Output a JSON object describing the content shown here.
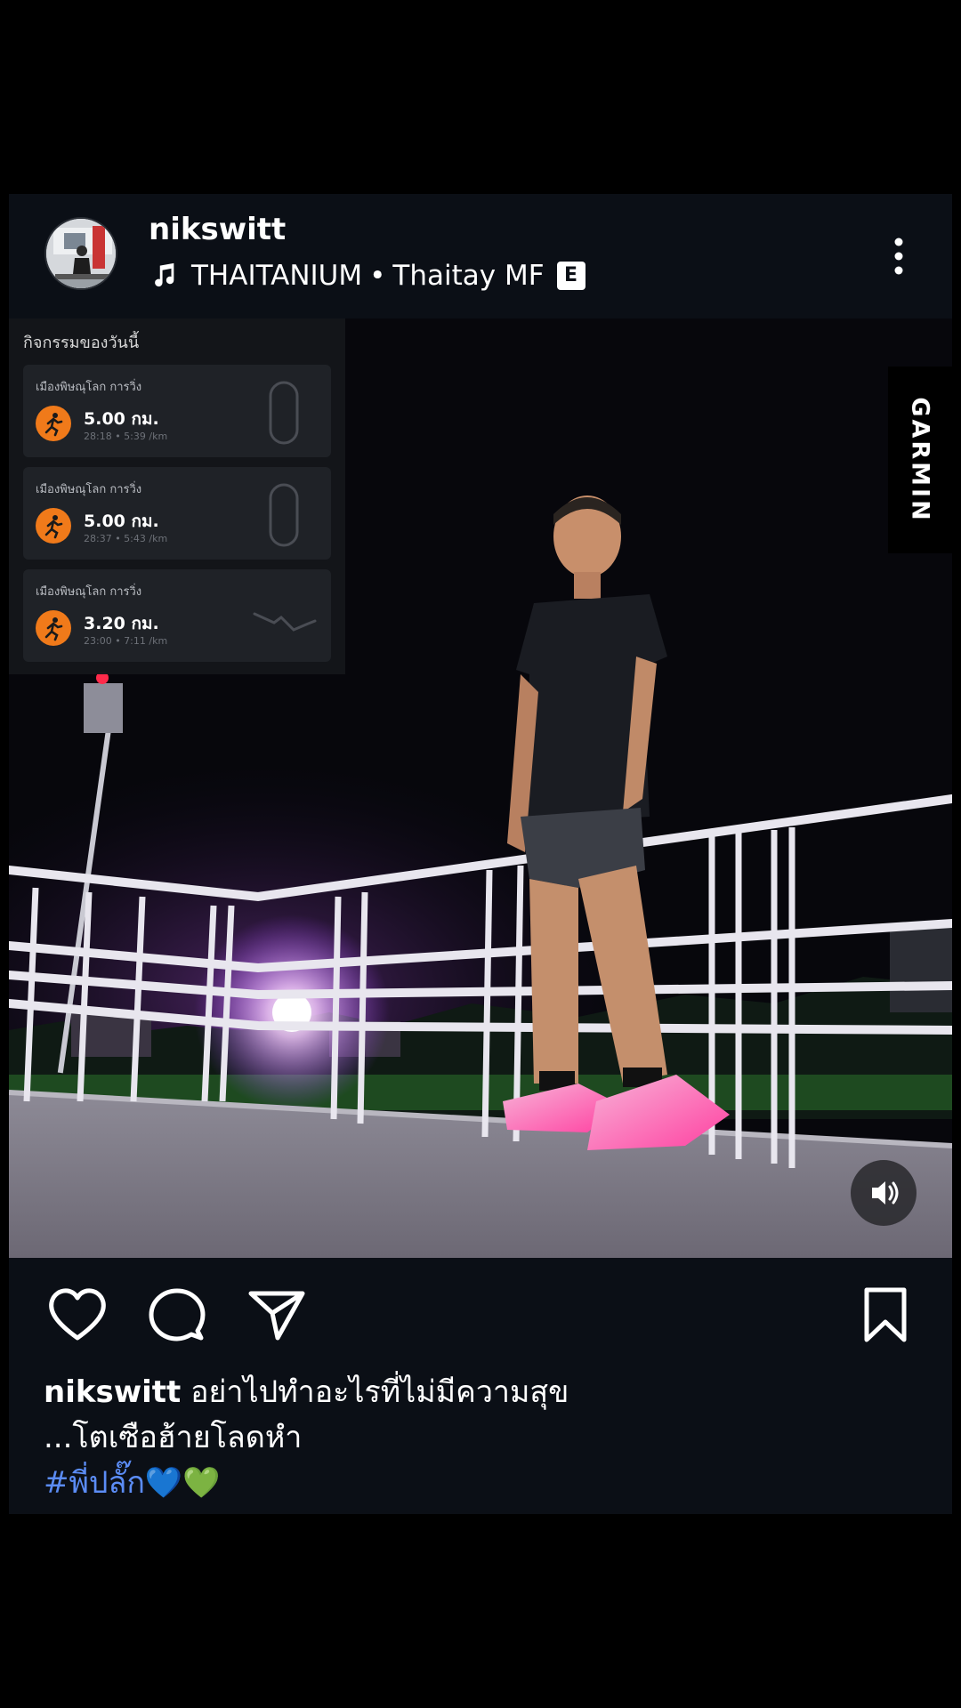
{
  "post": {
    "username": "nikswitt",
    "music": {
      "title": "THAITANIUM",
      "separator": "•",
      "artist": "Thaitay MF",
      "explicit_badge": "E"
    },
    "icons": {
      "music": "music-note-icon",
      "more": "more-vertical-icon",
      "sound": "speaker-icon",
      "like": "heart-icon",
      "comment": "comment-bubble-icon",
      "share": "send-paper-plane-icon",
      "save": "bookmark-icon"
    },
    "activity_overlay": {
      "title": "กิจกรรมของวันนี้",
      "items": [
        {
          "location": "เมืองพิษณุโลก การวิ่ง",
          "distance": "5.00 กม.",
          "detail": "28:18 • 5:39 /km"
        },
        {
          "location": "เมืองพิษณุโลก การวิ่ง",
          "distance": "5.00 กม.",
          "detail": "28:37 • 5:43 /km"
        },
        {
          "location": "เมืองพิษณุโลก การวิ่ง",
          "distance": "3.20 กม.",
          "detail": "23:00 • 7:11 /km"
        }
      ]
    },
    "brand_tag": "GARMIN",
    "caption": {
      "username": "nikswitt",
      "line1": "อย่าไปทำอะไรที่ไม่มีความสุข",
      "line2": "...โตเซือฮ้ายโลดหำ",
      "hashtag": "#พี่ปลั๊ก💙💚"
    },
    "colors": {
      "background": "#000000",
      "card": "#0b0f16",
      "hashtag": "#5b8cf5",
      "activity_orange": "#f07a1a"
    }
  }
}
